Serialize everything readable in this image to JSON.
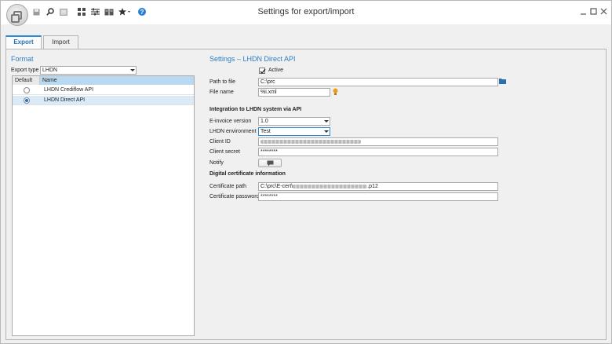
{
  "window": {
    "title": "Settings for export/import"
  },
  "tabs": [
    {
      "label": "Export",
      "active": true
    },
    {
      "label": "Import",
      "active": false
    }
  ],
  "format": {
    "section_title": "Format",
    "export_type_label": "Export type",
    "export_type_value": "LHDN",
    "grid": {
      "columns": [
        "Default",
        "Name"
      ],
      "rows": [
        {
          "default": false,
          "name": "LHDN Crediflow API"
        },
        {
          "default": true,
          "name": "LHDN Direct API"
        }
      ]
    }
  },
  "settings": {
    "section_title": "Settings – LHDN Direct API",
    "active_label": "Active",
    "active_checked": true,
    "path_label": "Path to file",
    "path_value": "C:\\prc",
    "filename_label": "File name",
    "filename_value": "%i.xml",
    "integration_title": "Integration to LHDN system via API",
    "einvoice_label": "E-invoice version",
    "einvoice_value": "1.0",
    "env_label": "LHDN environment",
    "env_value": "Test",
    "client_id_label": "Client ID",
    "client_secret_label": "Client secret",
    "client_secret_value": "********",
    "notify_label": "Notify",
    "cert_title": "Digital certificate information",
    "cert_path_label": "Certificate path",
    "cert_path_prefix": "C:\\prc\\E-cert\\",
    "cert_path_suffix": ".p12",
    "cert_password_label": "Certificate password",
    "cert_password_value": "********"
  },
  "colors": {
    "accent": "#2b7cc2",
    "grid_header_selected": "#b9d9f1",
    "row_selected": "#dbeaf7"
  }
}
